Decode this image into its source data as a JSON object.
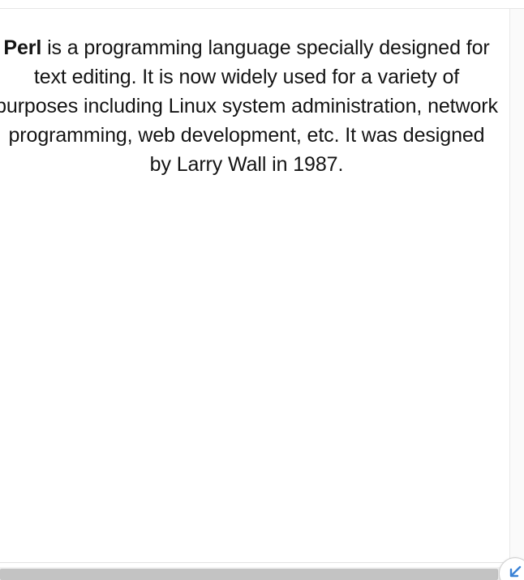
{
  "article": {
    "term": "Perl",
    "text": " is a programming language specially designed for text editing. It is now widely used for a variety of purposes including Linux system administration, network programming, web development, etc. It was designed by Larry Wall in 1987."
  },
  "icons": {
    "corner_button": "undo-arrow-icon"
  },
  "colors": {
    "text": "#141414",
    "icon_accent": "#3b82d6",
    "scrollbar_thumb": "#c3c3c3"
  }
}
